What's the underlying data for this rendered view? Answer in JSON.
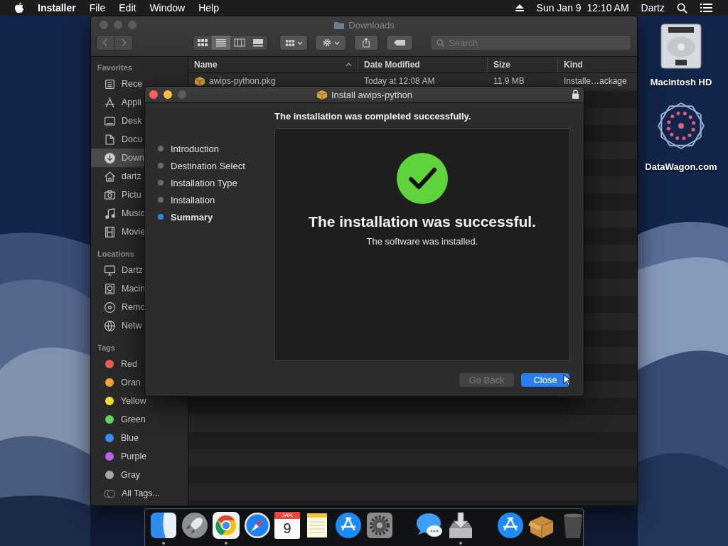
{
  "menu_bar": {
    "app_name": "Installer",
    "menus": [
      "File",
      "Edit",
      "Window",
      "Help"
    ],
    "clock": "Sun Jan 9  12:10 AM",
    "user": "Dartz"
  },
  "desktop_icons": [
    {
      "label": "Macintosh HD"
    },
    {
      "label": "DataWagon.com"
    }
  ],
  "finder": {
    "title": "Downloads",
    "lights": [
      {
        "color": "#5c5c5c"
      },
      {
        "color": "#5c5c5c"
      },
      {
        "color": "#5c5c5c"
      }
    ],
    "views": [
      {
        "selected": false
      },
      {
        "selected": true
      },
      {
        "selected": false
      },
      {
        "selected": false
      }
    ],
    "search": {
      "placeholder": "Search"
    },
    "sidebar": [
      {
        "title": "Favorites",
        "items": [
          {
            "kind": "place",
            "label": "Rece",
            "selected": false
          },
          {
            "kind": "place",
            "label": "Appli",
            "selected": false
          },
          {
            "kind": "place",
            "label": "Desk",
            "selected": false
          },
          {
            "kind": "place",
            "label": "Docu",
            "selected": false
          },
          {
            "kind": "place",
            "label": "Down",
            "selected": true
          },
          {
            "kind": "place",
            "label": "dartz",
            "selected": false
          },
          {
            "kind": "place",
            "label": "Pictu",
            "selected": false
          },
          {
            "kind": "place",
            "label": "Music",
            "selected": false
          },
          {
            "kind": "place",
            "label": "Movie",
            "selected": false
          }
        ]
      },
      {
        "title": "Locations",
        "items": [
          {
            "kind": "place",
            "label": "Dartz",
            "selected": false
          },
          {
            "kind": "place",
            "label": "Macin",
            "selected": false
          },
          {
            "kind": "place",
            "label": "Remo",
            "selected": false
          },
          {
            "kind": "place",
            "label": "Netw",
            "selected": false
          }
        ]
      },
      {
        "title": "Tags",
        "items": [
          {
            "kind": "tag",
            "label": "Red",
            "color": "#f45a55",
            "selected": false
          },
          {
            "kind": "tag",
            "label": "Oran",
            "color": "#f7a23a",
            "selected": false
          },
          {
            "kind": "tag",
            "label": "Yellow",
            "color": "#f5dd3b",
            "selected": false
          },
          {
            "kind": "tag",
            "label": "Green",
            "color": "#5ad65c",
            "selected": false
          },
          {
            "kind": "tag",
            "label": "Blue",
            "color": "#3a8ef5",
            "selected": false
          },
          {
            "kind": "tag",
            "label": "Purple",
            "color": "#bd5fe8",
            "selected": false
          },
          {
            "kind": "tag",
            "label": "Gray",
            "color": "#a6a6a6",
            "selected": false
          },
          {
            "kind": "all_tags",
            "label": "All Tags...",
            "selected": false
          }
        ]
      }
    ],
    "columns": [
      "Name",
      "Date Modified",
      "Size",
      "Kind"
    ],
    "rows": [
      {
        "cells": [
          "awips-python.pkg",
          "Today at 12:08 AM",
          "11.9 MB",
          "Installe…ackage"
        ]
      }
    ]
  },
  "installer": {
    "title": "Install awips-python",
    "lights": [
      {
        "color": "#fc605c"
      },
      {
        "color": "#fdbc40"
      },
      {
        "color": "#5b5b5b"
      }
    ],
    "heading": "The installation was completed successfully.",
    "steps": [
      {
        "label": "Introduction",
        "selected": false
      },
      {
        "label": "Destination Select",
        "selected": false
      },
      {
        "label": "Installation Type",
        "selected": false
      },
      {
        "label": "Installation",
        "selected": false
      },
      {
        "label": "Summary",
        "selected": true
      }
    ],
    "result": {
      "title": "The installation was successful.",
      "message": "The software was installed."
    },
    "buttons": [
      {
        "label": "Go Back",
        "kind": "secondary",
        "disabled": true
      },
      {
        "label": "Close",
        "kind": "primary",
        "disabled": false
      }
    ]
  },
  "dock": {
    "items": [
      {
        "kind": "app",
        "running": true
      },
      {
        "kind": "app",
        "running": false
      },
      {
        "kind": "app",
        "running": true
      },
      {
        "kind": "app",
        "running": false
      },
      {
        "kind": "calendar",
        "month": "JAN",
        "day": "9",
        "running": false
      },
      {
        "kind": "app",
        "running": false
      },
      {
        "kind": "app",
        "running": false
      },
      {
        "kind": "app",
        "running": false
      },
      {
        "kind": "separator"
      },
      {
        "kind": "app",
        "running": false
      },
      {
        "kind": "app",
        "running": true
      },
      {
        "kind": "separator"
      },
      {
        "kind": "app",
        "running": false
      },
      {
        "kind": "app",
        "running": false
      },
      {
        "kind": "app",
        "running": false
      }
    ]
  }
}
